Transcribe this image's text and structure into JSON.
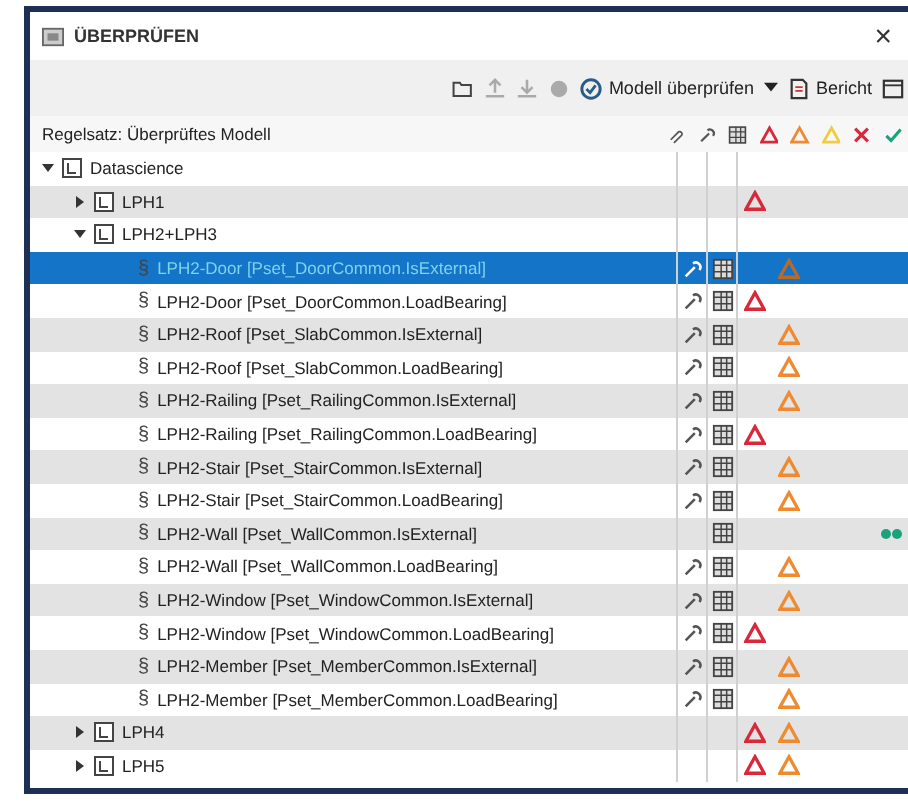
{
  "window": {
    "title": "ÜBERPRÜFEN",
    "close": "×"
  },
  "toolbar": {
    "check_button": "Modell überprüfen",
    "report_button": "Bericht"
  },
  "tree": {
    "header": "Regelsatz: Überprüftes Modell",
    "items": [
      {
        "label": "Datascience",
        "kind": "group",
        "expanded": true,
        "selected": false,
        "critical": false,
        "warning": false,
        "passed": false,
        "children": [
          {
            "label": "LPH1",
            "kind": "group",
            "expanded": false,
            "selected": false,
            "critical": true,
            "warning": false,
            "passed": false
          },
          {
            "label": "LPH2+LPH3",
            "kind": "group",
            "expanded": true,
            "selected": false,
            "critical": false,
            "warning": false,
            "passed": false,
            "children": [
              {
                "kind": "rule",
                "mark": "§",
                "label": "LPH2-Door [Pset_DoorCommon.IsExternal]",
                "selected": true,
                "wrench": true,
                "table": true,
                "critical": false,
                "warning": true,
                "passed": false
              },
              {
                "kind": "rule",
                "mark": "§",
                "label": "LPH2-Door [Pset_DoorCommon.LoadBearing]",
                "selected": false,
                "wrench": true,
                "table": true,
                "critical": true,
                "warning": false,
                "passed": false
              },
              {
                "kind": "rule",
                "mark": "§",
                "label": "LPH2-Roof [Pset_SlabCommon.IsExternal]",
                "selected": false,
                "wrench": true,
                "table": true,
                "critical": false,
                "warning": true,
                "passed": false
              },
              {
                "kind": "rule",
                "mark": "§",
                "label": "LPH2-Roof [Pset_SlabCommon.LoadBearing]",
                "selected": false,
                "wrench": true,
                "table": true,
                "critical": false,
                "warning": true,
                "passed": false
              },
              {
                "kind": "rule",
                "mark": "§",
                "label": "LPH2-Railing [Pset_RailingCommon.IsExternal]",
                "selected": false,
                "wrench": true,
                "table": true,
                "critical": false,
                "warning": true,
                "passed": false
              },
              {
                "kind": "rule",
                "mark": "§",
                "label": "LPH2-Railing [Pset_RailingCommon.LoadBearing]",
                "selected": false,
                "wrench": true,
                "table": true,
                "critical": true,
                "warning": false,
                "passed": false
              },
              {
                "kind": "rule",
                "mark": "§",
                "label": "LPH2-Stair [Pset_StairCommon.IsExternal]",
                "selected": false,
                "wrench": true,
                "table": true,
                "critical": false,
                "warning": true,
                "passed": false
              },
              {
                "kind": "rule",
                "mark": "§",
                "label": "LPH2-Stair [Pset_StairCommon.LoadBearing]",
                "selected": false,
                "wrench": true,
                "table": true,
                "critical": false,
                "warning": true,
                "passed": false
              },
              {
                "kind": "rule",
                "mark": "§",
                "label": "LPH2-Wall [Pset_WallCommon.IsExternal]",
                "selected": false,
                "wrench": false,
                "table": true,
                "critical": false,
                "warning": false,
                "passed": true
              },
              {
                "kind": "rule",
                "mark": "§",
                "label": "LPH2-Wall [Pset_WallCommon.LoadBearing]",
                "selected": false,
                "wrench": true,
                "table": true,
                "critical": false,
                "warning": true,
                "passed": false
              },
              {
                "kind": "rule",
                "mark": "§",
                "label": "LPH2-Window [Pset_WindowCommon.IsExternal]",
                "selected": false,
                "wrench": true,
                "table": true,
                "critical": false,
                "warning": true,
                "passed": false
              },
              {
                "kind": "rule",
                "mark": "§",
                "label": "LPH2-Window [Pset_WindowCommon.LoadBearing]",
                "selected": false,
                "wrench": true,
                "table": true,
                "critical": true,
                "warning": false,
                "passed": false
              },
              {
                "kind": "rule",
                "mark": "§",
                "label": "LPH2-Member [Pset_MemberCommon.IsExternal]",
                "selected": false,
                "wrench": true,
                "table": true,
                "critical": false,
                "warning": true,
                "passed": false
              },
              {
                "kind": "rule",
                "mark": "§",
                "label": "LPH2-Member [Pset_MemberCommon.LoadBearing]",
                "selected": false,
                "wrench": true,
                "table": true,
                "critical": false,
                "warning": true,
                "passed": false
              }
            ]
          },
          {
            "label": "LPH4",
            "kind": "group",
            "expanded": false,
            "selected": false,
            "critical": true,
            "warning": true,
            "passed": false
          },
          {
            "label": "LPH5",
            "kind": "group",
            "expanded": false,
            "selected": false,
            "critical": true,
            "warning": true,
            "passed": false
          }
        ]
      }
    ]
  }
}
